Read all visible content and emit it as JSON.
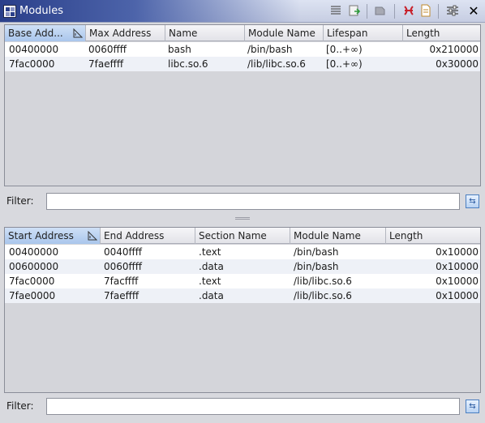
{
  "window": {
    "title": "Modules"
  },
  "toolbar": {
    "icons": [
      "list-icon",
      "export-icon",
      "plugin-icon",
      "bookmark-icon",
      "document-icon",
      "settings-icon",
      "close-icon"
    ]
  },
  "modules": {
    "columns": [
      "Base Add...",
      "Max Address",
      "Name",
      "Module Name",
      "Lifespan",
      "Length"
    ],
    "rows": [
      {
        "base": "00400000",
        "max": "0060ffff",
        "name": "bash",
        "module": "/bin/bash",
        "lifespan": "[0..+∞)",
        "length": "0x210000"
      },
      {
        "base": "7fac0000",
        "max": "7faeffff",
        "name": "libc.so.6",
        "module": "/lib/libc.so.6",
        "lifespan": "[0..+∞)",
        "length": "0x30000"
      }
    ],
    "filter_label": "Filter:",
    "filter_value": ""
  },
  "sections": {
    "columns": [
      "Start Address",
      "End Address",
      "Section Name",
      "Module Name",
      "Length"
    ],
    "rows": [
      {
        "start": "00400000",
        "end": "0040ffff",
        "section": ".text",
        "module": "/bin/bash",
        "length": "0x10000"
      },
      {
        "start": "00600000",
        "end": "0060ffff",
        "section": ".data",
        "module": "/bin/bash",
        "length": "0x10000"
      },
      {
        "start": "7fac0000",
        "end": "7facffff",
        "section": ".text",
        "module": "/lib/libc.so.6",
        "length": "0x10000"
      },
      {
        "start": "7fae0000",
        "end": "7faeffff",
        "section": ".data",
        "module": "/lib/libc.so.6",
        "length": "0x10000"
      }
    ],
    "filter_label": "Filter:",
    "filter_value": ""
  }
}
